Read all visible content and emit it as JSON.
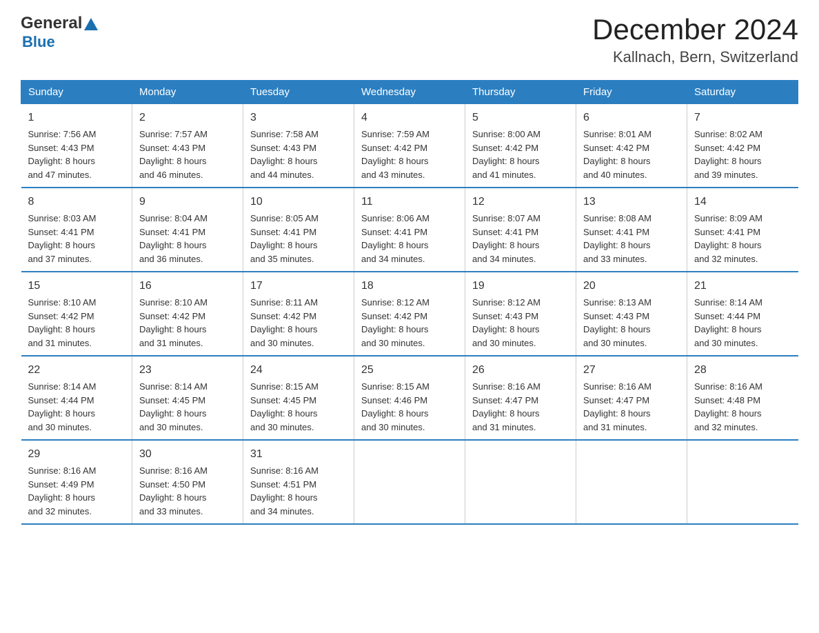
{
  "header": {
    "logo_text_black": "General",
    "logo_text_blue": "Blue",
    "month": "December 2024",
    "location": "Kallnach, Bern, Switzerland"
  },
  "weekdays": [
    "Sunday",
    "Monday",
    "Tuesday",
    "Wednesday",
    "Thursday",
    "Friday",
    "Saturday"
  ],
  "weeks": [
    [
      {
        "day": "1",
        "sunrise": "7:56 AM",
        "sunset": "4:43 PM",
        "daylight": "8 hours and 47 minutes."
      },
      {
        "day": "2",
        "sunrise": "7:57 AM",
        "sunset": "4:43 PM",
        "daylight": "8 hours and 46 minutes."
      },
      {
        "day": "3",
        "sunrise": "7:58 AM",
        "sunset": "4:43 PM",
        "daylight": "8 hours and 44 minutes."
      },
      {
        "day": "4",
        "sunrise": "7:59 AM",
        "sunset": "4:42 PM",
        "daylight": "8 hours and 43 minutes."
      },
      {
        "day": "5",
        "sunrise": "8:00 AM",
        "sunset": "4:42 PM",
        "daylight": "8 hours and 41 minutes."
      },
      {
        "day": "6",
        "sunrise": "8:01 AM",
        "sunset": "4:42 PM",
        "daylight": "8 hours and 40 minutes."
      },
      {
        "day": "7",
        "sunrise": "8:02 AM",
        "sunset": "4:42 PM",
        "daylight": "8 hours and 39 minutes."
      }
    ],
    [
      {
        "day": "8",
        "sunrise": "8:03 AM",
        "sunset": "4:41 PM",
        "daylight": "8 hours and 37 minutes."
      },
      {
        "day": "9",
        "sunrise": "8:04 AM",
        "sunset": "4:41 PM",
        "daylight": "8 hours and 36 minutes."
      },
      {
        "day": "10",
        "sunrise": "8:05 AM",
        "sunset": "4:41 PM",
        "daylight": "8 hours and 35 minutes."
      },
      {
        "day": "11",
        "sunrise": "8:06 AM",
        "sunset": "4:41 PM",
        "daylight": "8 hours and 34 minutes."
      },
      {
        "day": "12",
        "sunrise": "8:07 AM",
        "sunset": "4:41 PM",
        "daylight": "8 hours and 34 minutes."
      },
      {
        "day": "13",
        "sunrise": "8:08 AM",
        "sunset": "4:41 PM",
        "daylight": "8 hours and 33 minutes."
      },
      {
        "day": "14",
        "sunrise": "8:09 AM",
        "sunset": "4:41 PM",
        "daylight": "8 hours and 32 minutes."
      }
    ],
    [
      {
        "day": "15",
        "sunrise": "8:10 AM",
        "sunset": "4:42 PM",
        "daylight": "8 hours and 31 minutes."
      },
      {
        "day": "16",
        "sunrise": "8:10 AM",
        "sunset": "4:42 PM",
        "daylight": "8 hours and 31 minutes."
      },
      {
        "day": "17",
        "sunrise": "8:11 AM",
        "sunset": "4:42 PM",
        "daylight": "8 hours and 30 minutes."
      },
      {
        "day": "18",
        "sunrise": "8:12 AM",
        "sunset": "4:42 PM",
        "daylight": "8 hours and 30 minutes."
      },
      {
        "day": "19",
        "sunrise": "8:12 AM",
        "sunset": "4:43 PM",
        "daylight": "8 hours and 30 minutes."
      },
      {
        "day": "20",
        "sunrise": "8:13 AM",
        "sunset": "4:43 PM",
        "daylight": "8 hours and 30 minutes."
      },
      {
        "day": "21",
        "sunrise": "8:14 AM",
        "sunset": "4:44 PM",
        "daylight": "8 hours and 30 minutes."
      }
    ],
    [
      {
        "day": "22",
        "sunrise": "8:14 AM",
        "sunset": "4:44 PM",
        "daylight": "8 hours and 30 minutes."
      },
      {
        "day": "23",
        "sunrise": "8:14 AM",
        "sunset": "4:45 PM",
        "daylight": "8 hours and 30 minutes."
      },
      {
        "day": "24",
        "sunrise": "8:15 AM",
        "sunset": "4:45 PM",
        "daylight": "8 hours and 30 minutes."
      },
      {
        "day": "25",
        "sunrise": "8:15 AM",
        "sunset": "4:46 PM",
        "daylight": "8 hours and 30 minutes."
      },
      {
        "day": "26",
        "sunrise": "8:16 AM",
        "sunset": "4:47 PM",
        "daylight": "8 hours and 31 minutes."
      },
      {
        "day": "27",
        "sunrise": "8:16 AM",
        "sunset": "4:47 PM",
        "daylight": "8 hours and 31 minutes."
      },
      {
        "day": "28",
        "sunrise": "8:16 AM",
        "sunset": "4:48 PM",
        "daylight": "8 hours and 32 minutes."
      }
    ],
    [
      {
        "day": "29",
        "sunrise": "8:16 AM",
        "sunset": "4:49 PM",
        "daylight": "8 hours and 32 minutes."
      },
      {
        "day": "30",
        "sunrise": "8:16 AM",
        "sunset": "4:50 PM",
        "daylight": "8 hours and 33 minutes."
      },
      {
        "day": "31",
        "sunrise": "8:16 AM",
        "sunset": "4:51 PM",
        "daylight": "8 hours and 34 minutes."
      },
      null,
      null,
      null,
      null
    ]
  ]
}
